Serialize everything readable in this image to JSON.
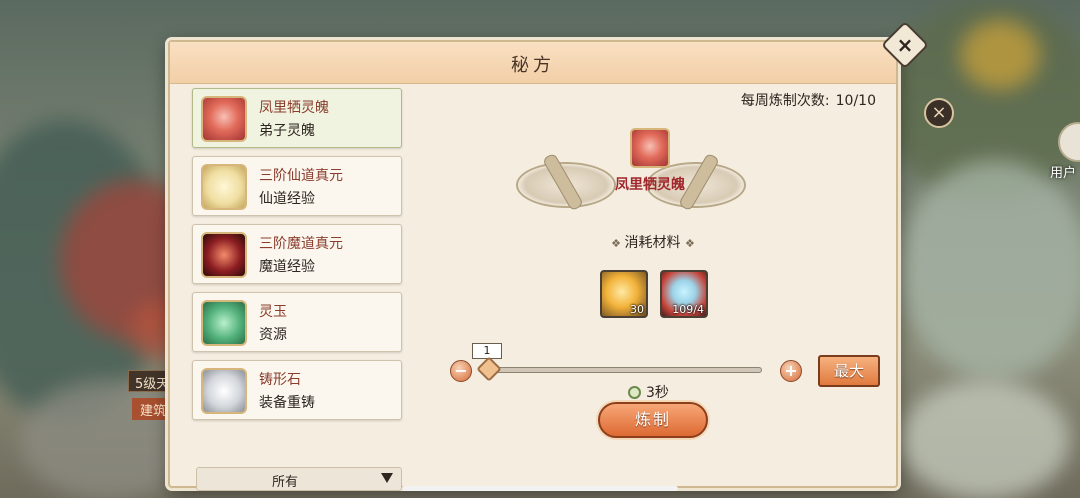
{
  "dialog": {
    "title": "秘方",
    "close_icon": "×"
  },
  "recipes": [
    {
      "name": "凤里牺灵魄",
      "desc": "弟子灵魄",
      "icon": "soul-icon",
      "selected": true
    },
    {
      "name": "三阶仙道真元",
      "desc": "仙道经验",
      "icon": "xian-essence-icon",
      "selected": false
    },
    {
      "name": "三阶魔道真元",
      "desc": "魔道经验",
      "icon": "mo-essence-icon",
      "selected": false
    },
    {
      "name": "灵玉",
      "desc": "资源",
      "icon": "jade-icon",
      "selected": false
    },
    {
      "name": "铸形石",
      "desc": "装备重铸",
      "icon": "stone-icon",
      "selected": false
    }
  ],
  "filter": {
    "label": "所有"
  },
  "detail": {
    "weekly_label": "每周炼制次数:",
    "weekly_value": "10/10",
    "result_name": "凤里牺灵魄",
    "materials_title": "消耗材料",
    "materials": [
      {
        "icon": "gold-orb-icon",
        "count": "30"
      },
      {
        "icon": "crystal-heart-icon",
        "count": "109/4"
      }
    ],
    "quantity": "1",
    "slider_fraction": 0.0,
    "max_label": "最大",
    "time": "3秒",
    "craft_label": "炼制"
  },
  "background": {
    "tag1": "5级天",
    "tag2": "建筑",
    "user_label": "用户"
  }
}
